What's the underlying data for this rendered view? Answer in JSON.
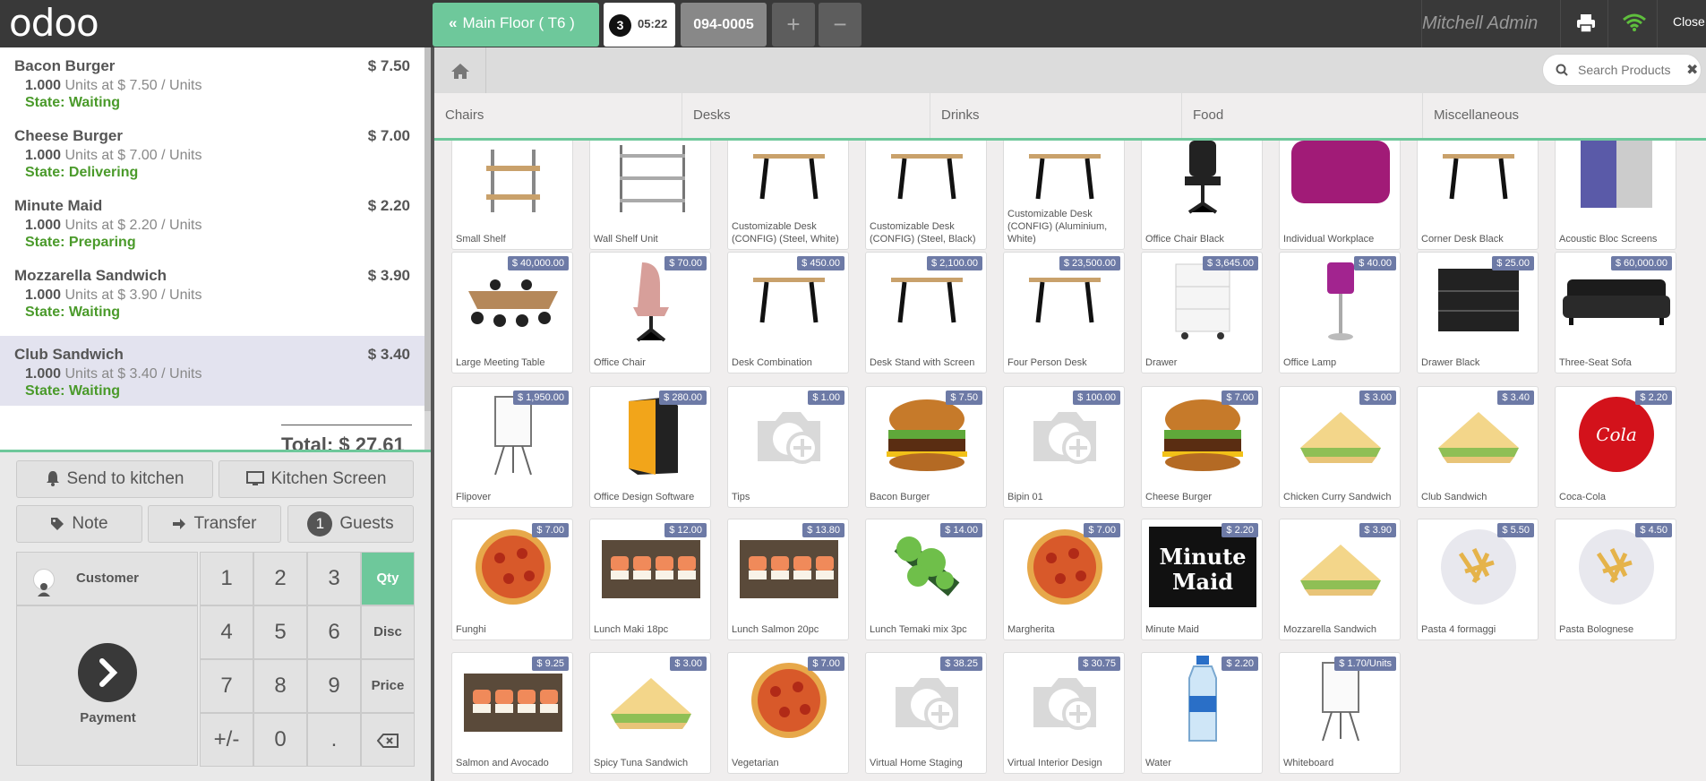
{
  "app": {
    "logo": "odoo"
  },
  "topbar": {
    "floor_label": "Main Floor ( T6 )",
    "active_order": {
      "guests_badge": "3",
      "time": "05:22"
    },
    "other_order": "094-0005",
    "add_symbol": "+",
    "remove_symbol": "−",
    "user": "Mitchell Admin",
    "close": "Close"
  },
  "order": {
    "lines": [
      {
        "name": "Bacon Burger",
        "price": "$ 7.50",
        "qty": "1.000",
        "detail": "Units at $ 7.50 / Units",
        "state": "State: Waiting"
      },
      {
        "name": "Cheese Burger",
        "price": "$ 7.00",
        "qty": "1.000",
        "detail": "Units at $ 7.00 / Units",
        "state": "State: Delivering"
      },
      {
        "name": "Minute Maid",
        "price": "$ 2.20",
        "qty": "1.000",
        "detail": "Units at $ 2.20 / Units",
        "state": "State: Preparing"
      },
      {
        "name": "Mozzarella Sandwich",
        "price": "$ 3.90",
        "qty": "1.000",
        "detail": "Units at $ 3.90 / Units",
        "state": "State: Waiting"
      },
      {
        "name": "Club Sandwich",
        "price": "$ 3.40",
        "qty": "1.000",
        "detail": "Units at $ 3.40 / Units",
        "state": "State: Waiting"
      }
    ],
    "total": "Total: $ 27.61"
  },
  "controls": {
    "send_kitchen": "Send to kitchen",
    "kitchen_screen": "Kitchen Screen",
    "note": "Note",
    "transfer": "Transfer",
    "guests_count": "1",
    "guests": "Guests"
  },
  "numpad": {
    "customer": "Customer",
    "payment": "Payment",
    "keys": [
      "1",
      "2",
      "3",
      "4",
      "5",
      "6",
      "7",
      "8",
      "9",
      "+/-",
      "0",
      "."
    ],
    "modes": [
      "Qty",
      "Disc",
      "Price"
    ]
  },
  "search": {
    "placeholder": "Search Products"
  },
  "categories": [
    "Chairs",
    "Desks",
    "Drinks",
    "Food",
    "Miscellaneous"
  ],
  "products": [
    {
      "name": "Small Shelf",
      "price": ""
    },
    {
      "name": "Wall Shelf Unit",
      "price": ""
    },
    {
      "name": "Customizable Desk (CONFIG) (Steel, White)",
      "price": ""
    },
    {
      "name": "Customizable Desk (CONFIG) (Steel, Black)",
      "price": ""
    },
    {
      "name": "Customizable Desk (CONFIG) (Aluminium, White)",
      "price": ""
    },
    {
      "name": "Office Chair Black",
      "price": ""
    },
    {
      "name": "Individual Workplace",
      "price": ""
    },
    {
      "name": "Corner Desk Black",
      "price": ""
    },
    {
      "name": "Acoustic Bloc Screens",
      "price": ""
    },
    {
      "name": "Large Meeting Table",
      "price": "$ 40,000.00"
    },
    {
      "name": "Office Chair",
      "price": "$ 70.00"
    },
    {
      "name": "Desk Combination",
      "price": "$ 450.00"
    },
    {
      "name": "Desk Stand with Screen",
      "price": "$ 2,100.00"
    },
    {
      "name": "Four Person Desk",
      "price": "$ 23,500.00"
    },
    {
      "name": "Drawer",
      "price": "$ 3,645.00"
    },
    {
      "name": "Office Lamp",
      "price": "$ 40.00"
    },
    {
      "name": "Drawer Black",
      "price": "$ 25.00"
    },
    {
      "name": "Three-Seat Sofa",
      "price": "$ 60,000.00"
    },
    {
      "name": "Flipover",
      "price": "$ 1,950.00"
    },
    {
      "name": "Office Design Software",
      "price": "$ 280.00"
    },
    {
      "name": "Tips",
      "price": "$ 1.00"
    },
    {
      "name": "Bacon Burger",
      "price": "$ 7.50"
    },
    {
      "name": "Bipin 01",
      "price": "$ 100.00"
    },
    {
      "name": "Cheese Burger",
      "price": "$ 7.00"
    },
    {
      "name": "Chicken Curry Sandwich",
      "price": "$ 3.00"
    },
    {
      "name": "Club Sandwich",
      "price": "$ 3.40"
    },
    {
      "name": "Coca-Cola",
      "price": "$ 2.20"
    },
    {
      "name": "Funghi",
      "price": "$ 7.00"
    },
    {
      "name": "Lunch Maki 18pc",
      "price": "$ 12.00"
    },
    {
      "name": "Lunch Salmon 20pc",
      "price": "$ 13.80"
    },
    {
      "name": "Lunch Temaki mix 3pc",
      "price": "$ 14.00"
    },
    {
      "name": "Margherita",
      "price": "$ 7.00"
    },
    {
      "name": "Minute Maid",
      "price": "$ 2.20"
    },
    {
      "name": "Mozzarella Sandwich",
      "price": "$ 3.90"
    },
    {
      "name": "Pasta 4 formaggi",
      "price": "$ 5.50"
    },
    {
      "name": "Pasta Bolognese",
      "price": "$ 4.50"
    },
    {
      "name": "Salmon and Avocado",
      "price": "$ 9.25"
    },
    {
      "name": "Spicy Tuna Sandwich",
      "price": "$ 3.00"
    },
    {
      "name": "Vegetarian",
      "price": "$ 7.00"
    },
    {
      "name": "Virtual Home Staging",
      "price": "$ 38.25"
    },
    {
      "name": "Virtual Interior Design",
      "price": "$ 30.75"
    },
    {
      "name": "Water",
      "price": "$ 2.20"
    },
    {
      "name": "Whiteboard",
      "price": "$ 1.70/Units"
    }
  ],
  "colors": {
    "accent": "#6ec89b",
    "topbar": "#393939",
    "price_badge": "#6d7aa6",
    "state_text": "#4a9a2a"
  }
}
